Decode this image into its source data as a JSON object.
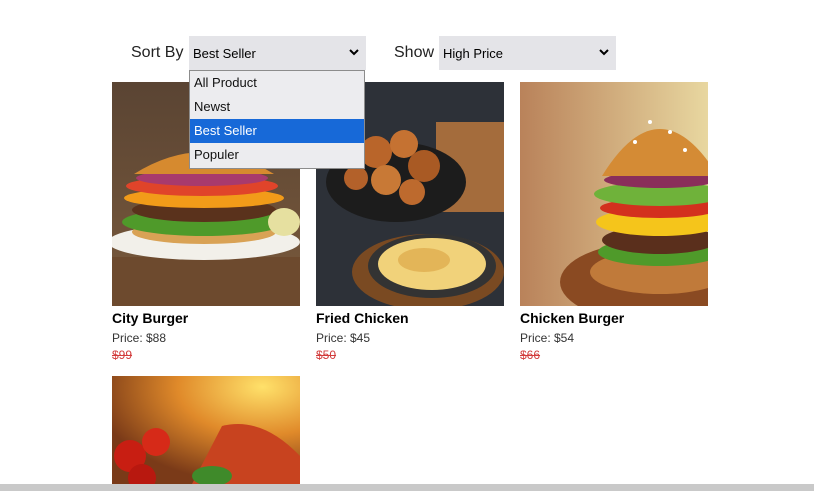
{
  "filters": {
    "sort_label": "Sort By :",
    "sort_selected": "Best Seller",
    "sort_options": [
      "All Product",
      "Newst",
      "Best Seller",
      "Populer"
    ],
    "show_label": "Show :",
    "show_selected": "High Price"
  },
  "products": [
    {
      "name": "City Burger",
      "price": "Price: $88",
      "old_price": "$99"
    },
    {
      "name": "Fried Chicken",
      "price": "Price: $45",
      "old_price": "$50"
    },
    {
      "name": "Chicken Burger",
      "price": "Price: $54",
      "old_price": "$66"
    }
  ],
  "colors": {
    "highlight": "#1769d8",
    "old_price": "#d23b3b",
    "select_bg": "#e4e4e8"
  },
  "icons": {
    "select_arrow": "chevron-down-icon"
  }
}
